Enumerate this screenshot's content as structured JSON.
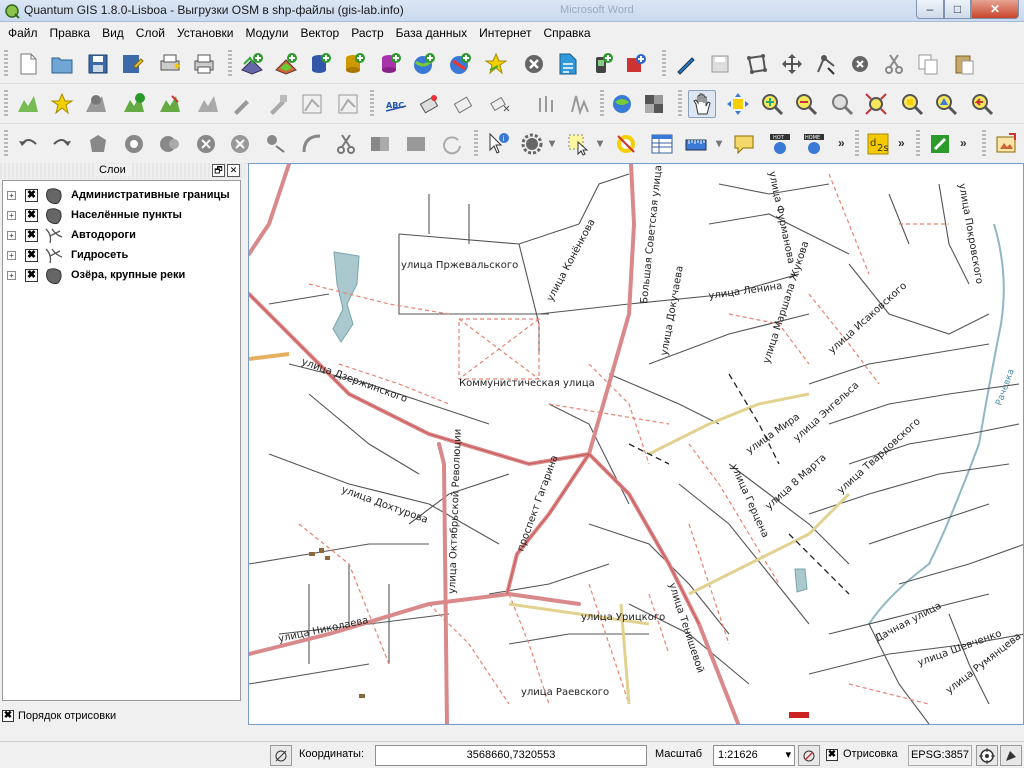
{
  "window": {
    "title": "Quantum GIS 1.8.0-Lisboa - Выгрузки OSM в shp-файлы (gis-lab.info)",
    "background_task": "Microsoft Word",
    "minimize": "–",
    "maximize": "□",
    "close": "✕"
  },
  "menu": [
    {
      "label": "Файл"
    },
    {
      "label": "Правка"
    },
    {
      "label": "Вид"
    },
    {
      "label": "Слой"
    },
    {
      "label": "Установки"
    },
    {
      "label": "Модули"
    },
    {
      "label": "Вектор"
    },
    {
      "label": "Растр"
    },
    {
      "label": "База данных"
    },
    {
      "label": "Интернет"
    },
    {
      "label": "Справка"
    }
  ],
  "layers_panel": {
    "title": "Слои",
    "float_button": "🗗",
    "close_button": "✕",
    "layers": [
      {
        "name": "Административные границы",
        "checked": "✖",
        "expand": "+",
        "icon": "polygon-layer-icon"
      },
      {
        "name": "Населённые пункты",
        "checked": "✖",
        "expand": "+",
        "icon": "polygon-layer-icon"
      },
      {
        "name": "Автодороги",
        "checked": "✖",
        "expand": "+",
        "icon": "line-layer-icon"
      },
      {
        "name": "Гидросеть",
        "checked": "✖",
        "expand": "+",
        "icon": "line-layer-icon"
      },
      {
        "name": "Озёра, крупные реки",
        "checked": "✖",
        "expand": "+",
        "icon": "polygon-layer-icon"
      }
    ],
    "render_order": {
      "label": "Порядок отрисовки",
      "checked": "✖"
    }
  },
  "map": {
    "labels": {
      "prz": "улица Пржевальского",
      "kon": "улица Конёнкова",
      "bsov": "Большая Советская улица",
      "dok": "улица Докучаева",
      "len": "улица Ленина",
      "fur": "улица Фурманова",
      "mzh": "улица Маршала Жукова",
      "isak": "улица Исаковского",
      "pok": "улица Покровского",
      "dzh": "улица Дзержинского",
      "komm": "Коммунистическая улица",
      "mira": "улица Мира",
      "eng": "улица Энгельса",
      "tvar": "улица Твардовского",
      "vmar": "улица 8 Марта",
      "gerc": "улица Герцена",
      "gag": "проспект Гагарина",
      "oktr": "улица Октябрьской Революции",
      "dokh": "улица Дохтурова",
      "urick": "улица Урицкого",
      "tenish": "улица Тенишевой",
      "nikol": "улица Николаева",
      "raev": "улица Раевского",
      "dach": "Дачная улица",
      "shev": "улица Шевченко",
      "rum": "улица Румянцева",
      "rach": "Рачевка"
    }
  },
  "status": {
    "coord_label": "Координаты:",
    "coord_value": "3568660,7320553",
    "scale_label": "Масштаб",
    "scale_value": "1:21626",
    "render_label": "Отрисовка",
    "render_checked": "✖",
    "epsg": "EPSG:3857"
  }
}
